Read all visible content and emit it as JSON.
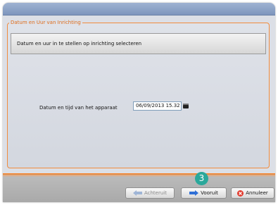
{
  "group": {
    "title": "Datum en Uur van Inrichting"
  },
  "description": "Datum en uur in te stellen op inrichting selecteren",
  "datetime": {
    "label": "Datum en tijd van het apparaat",
    "value": "06/09/2013 15.32"
  },
  "buttons": {
    "back": "Achteruit",
    "next": "Vooruit",
    "cancel": "Annuleer"
  },
  "step_badge": "3",
  "icons": {
    "back": "arrow-left-icon",
    "next": "arrow-right-icon",
    "cancel": "cancel-icon",
    "picker": "calendar-icon"
  },
  "colors": {
    "accent": "#f08b3d",
    "badge": "#2aa89b",
    "next_arrow": "#2f6fd6",
    "cancel_icon": "#e23b2e"
  }
}
